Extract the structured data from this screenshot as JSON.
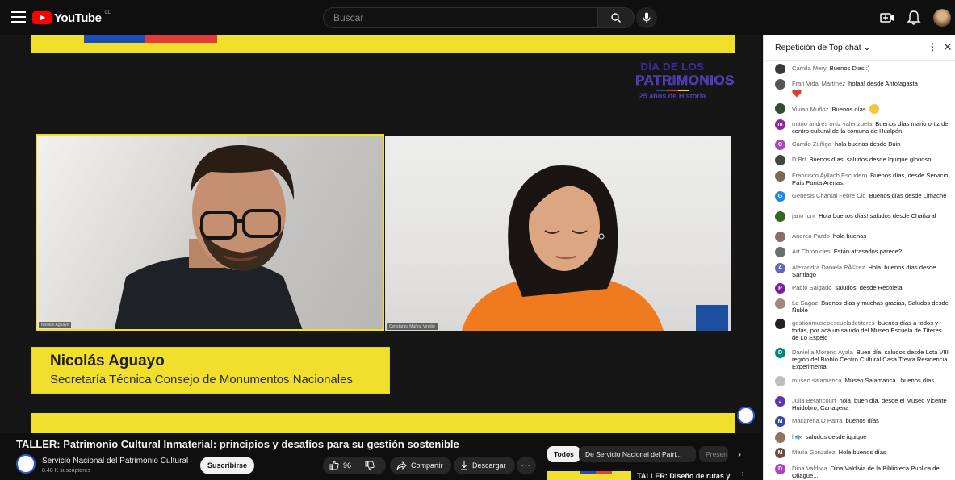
{
  "header": {
    "logo_text": "YouTube",
    "country_code": "CL",
    "search_placeholder": "Buscar"
  },
  "video": {
    "event_logo": {
      "line1": "DÍA DE LOS",
      "line2": "PATRIMONIOS",
      "line3": "25 años de Historia"
    },
    "speaker_name": "Nicolás Aguayo",
    "speaker_role": "Secretaría Técnica Consejo de Monumentos Nacionales",
    "left_cam_label": "Nicolás Aguayo",
    "right_cam_label": "Constanza Muñoz Virgilio"
  },
  "info": {
    "title": "TALLER: Patrimonio Cultural Inmaterial: principios y desafíos para su gestión sostenible",
    "channel_name": "Servicio Nacional del Patrimonio Cultural",
    "subscribers": "8.48 K suscriptores",
    "subscribe_label": "Suscribirse",
    "likes": "96",
    "share_label": "Compartir",
    "download_label": "Descargar",
    "more_label": "···"
  },
  "related": {
    "chips": [
      "Todos",
      "De Servicio Nacional del Patri...",
      "Presen"
    ],
    "first_title": "TALLER: Diseño de rutas y"
  },
  "chat": {
    "mode_label": "Repetición de Top chat",
    "messages": [
      {
        "author": "Camila Mery",
        "text": "Buenos Dias :)",
        "initial": "",
        "color": "#3a3a3a"
      },
      {
        "author": "Fran Vidal Martínez",
        "text": "holaa! desde Antofagasta",
        "initial": "",
        "color": "#555555",
        "heart": true
      },
      {
        "author": "Vivian Muñoz",
        "text": "Buenos días",
        "initial": "",
        "color": "#2f4f2f",
        "smile": true
      },
      {
        "author": "mario andres ortiz valenzuela",
        "text": "Buenos días mario ortiz del centro cultural de la comuna de Hualpén",
        "initial": "m",
        "color": "#8e24aa"
      },
      {
        "author": "Camilo Zuñiga",
        "text": "hola buenas desde Buin",
        "initial": "C",
        "color": "#ab47bc"
      },
      {
        "author": "D Brt",
        "text": "Buenos días, saludos desde Iquique glorioso",
        "initial": "",
        "color": "#444444"
      },
      {
        "author": "Francisco Ayllach Escudero",
        "text": "Buenos días, desde Servicio País Punta Arenas.",
        "initial": "",
        "color": "#7a6a55"
      },
      {
        "author": "Genesis Chantal Febre Cid",
        "text": "Buenos días desde Limache",
        "initial": "G",
        "color": "#1e88e5"
      },
      {
        "author": "jano font",
        "text": "Hola buenos días! saludos desde Chañaral",
        "initial": "",
        "color": "#33691e"
      },
      {
        "author": "Andrea Pardo",
        "text": "hola buenas",
        "initial": "",
        "color": "#8d6e63"
      },
      {
        "author": "Art Chronicles",
        "text": "Están atrasados parece?",
        "initial": "",
        "color": "#6d6d6d"
      },
      {
        "author": "Alexandra Daniela PÃ©rez",
        "text": "Hola, buenos días desde Santiago",
        "initial": "A",
        "color": "#5c6bc0"
      },
      {
        "author": "Pablo Salgado",
        "text": "saludos, desde Recoleta",
        "initial": "P",
        "color": "#7b1fa2"
      },
      {
        "author": "La Sagaz",
        "text": "Buenos días y muchas gracias, Saludos desde Ñuble",
        "initial": "",
        "color": "#a1887f"
      },
      {
        "author": "gestionmuseoescueladetiteres",
        "text": "buenos días a todos y todas, por acá un saludo del Museo Escuela de Títeres de Lo Espejo",
        "initial": "",
        "color": "#222222"
      },
      {
        "author": "Daniella Moreno Ayala",
        "text": "Buen día, saludos desde Lota VIII región del Biobío Centro Cultural Casa Trewa Residencia Experimental",
        "initial": "D",
        "color": "#00897b"
      },
      {
        "author": "museo salamanca",
        "text": "Museo Salamanca...buenos días",
        "initial": "",
        "color": "#bdbdbd"
      },
      {
        "author": "Julia Betancourt",
        "text": "hola, buen día, desde el Museo Vicente Huidobro, Cartagena",
        "initial": "J",
        "color": "#5e35b1"
      },
      {
        "author": "Macarena.O Parra",
        "text": "buenos días",
        "initial": "M",
        "color": "#3949ab"
      },
      {
        "author": "li🐟",
        "text": "saludos desde iquique",
        "initial": "",
        "color": "#8a7560"
      },
      {
        "author": "María Gonzalez",
        "text": "Hola buenos días",
        "initial": "M",
        "color": "#6d4c41"
      },
      {
        "author": "Dina Valdivia",
        "text": "Dina Valdivia de la Biblioteca Publica de Ollague...",
        "initial": "D",
        "color": "#ab47bc"
      }
    ]
  },
  "colors": {
    "brand_yellow": "#f0e02b",
    "youtube_red": "#ff0000",
    "flag_blue": "#1d4eb8",
    "flag_red": "#e23b3b",
    "orange_shirt": "#f07a1f"
  }
}
